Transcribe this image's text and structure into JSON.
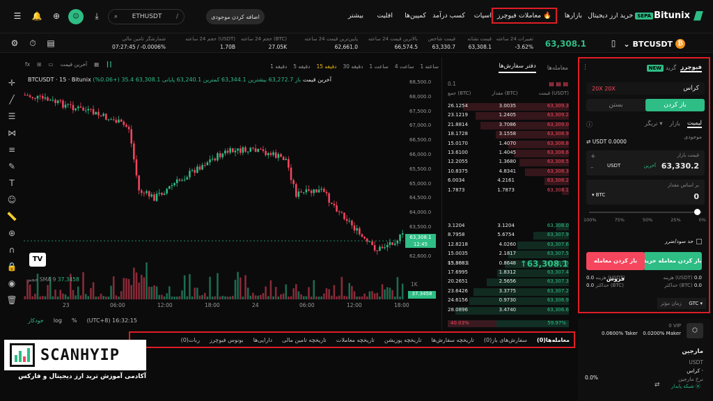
{
  "nav": {
    "brand": "Bitunix",
    "items": [
      "خرید ارز دیجیتال",
      "بازارها",
      "معاملات فیوچرز",
      "اسپات",
      "کسب درآمد",
      "کمپین‌ها",
      "افلیت",
      "بیشتر"
    ],
    "sepa": "SEPA",
    "search": "ETHUSDT",
    "deposit": "اضافه کردن موجودی"
  },
  "ticker": {
    "symbol": "BTCUSDT",
    "last": "63,308.1",
    "stats": [
      {
        "l": "تغییرات 24 ساعته",
        "v": "-3.62%"
      },
      {
        "l": "قیمت نشانه",
        "v": "63,308.1"
      },
      {
        "l": "قیمت شاخص",
        "v": "63,330.7"
      },
      {
        "l": "بالاترین قیمت 24 ساعته",
        "v": "66,574.5"
      },
      {
        "l": "پایین‌ترین قیمت 24 ساعته",
        "v": "62,661.0"
      },
      {
        "l": "حجم 24 ساعته (BTC)",
        "v": "27.05K"
      },
      {
        "l": "حجم 24 ساعته (USDT)",
        "v": "1.70B"
      },
      {
        "l": "شمارشگر تامین مالی",
        "v": "07:27:45 / -0.0006%"
      }
    ]
  },
  "chart": {
    "pair_line": "BTCUSDT · 15 · Bitunix آخرین قیمت",
    "ohlc": "باز 63,272.7  بیشترین 63,344.1  کمترین 63,240.1  پایانی 63,308.1  35.4 (+0.06%)",
    "intervals": [
      "1 دقیقه",
      "5 دقیقه",
      "15 دقیقه",
      "30 دقیقه",
      "1 ساعت",
      "4 ساعت",
      "1 ساعته"
    ],
    "price_type": "آخرین قیمت",
    "yticks": [
      "68,500.0",
      "68,000.0",
      "67,500.0",
      "67,000.0",
      "66,500.0",
      "66,000.0",
      "65,500.0",
      "65,000.0",
      "64,500.0",
      "64,000.0",
      "63,500.0",
      "63,000.0",
      "62,600.0"
    ],
    "xticks": [
      "23",
      "06:00",
      "12:00",
      "18:00",
      "24",
      "06:00",
      "12:00",
      "18:00"
    ],
    "price_tag": "63,308.1",
    "price_time": "12:45",
    "vol_label": "حجم",
    "sma": "SMA 9",
    "sma_val": "37.3458",
    "vol_tick": "1K",
    "vol_tag": "37.3458",
    "footer_time": "(UTC+8) 16:32:15",
    "footer_opts": [
      "%",
      "log",
      "خودکار"
    ]
  },
  "book": {
    "tabs": [
      "دفتر سفارش‌ها",
      "معامله‌ها"
    ],
    "step": "0.1",
    "headers": [
      "قیمت (USDT)",
      "مقدار (BTC)",
      "جمع (BTC)"
    ],
    "asks": [
      [
        "63,309.3",
        "3.0035",
        "26.1254"
      ],
      [
        "63,309.2",
        "1.2405",
        "23.1219"
      ],
      [
        "63,309.0",
        "3.7086",
        "21.8814"
      ],
      [
        "63,308.9",
        "3.1558",
        "18.1728"
      ],
      [
        "63,308.8",
        "1.4070",
        "15.0170"
      ],
      [
        "63,308.6",
        "1.4045",
        "13.6100"
      ],
      [
        "63,308.5",
        "1.3680",
        "12.2055"
      ],
      [
        "63,308.3",
        "4.8341",
        "10.8375"
      ],
      [
        "63,308.2",
        "4.2161",
        "6.0034"
      ],
      [
        "63,308.1",
        "1.7873",
        "1.7873"
      ]
    ],
    "mid": "↑63,308.1",
    "mid_sub": "63,308.1",
    "bids": [
      [
        "63,308.0",
        "3.1204",
        "3.1204"
      ],
      [
        "63,307.9",
        "5.6754",
        "8.7958"
      ],
      [
        "63,307.6",
        "4.0260",
        "12.8218"
      ],
      [
        "63,307.5",
        "2.1817",
        "15.0035"
      ],
      [
        "63,307.5",
        "0.8648",
        "15.8683"
      ],
      [
        "63,307.4",
        "1.8312",
        "17.6995"
      ],
      [
        "63,307.3",
        "2.5656",
        "20.2651"
      ],
      [
        "63,307.2",
        "3.3775",
        "23.6426"
      ],
      [
        "63,306.9",
        "0.9730",
        "24.6156"
      ],
      [
        "63,306.6",
        "3.4740",
        "28.0896"
      ]
    ],
    "ratio_b": "59.97%",
    "ratio_s": "40.03%"
  },
  "panel": {
    "title": "فیوچرز",
    "grid": "گرید",
    "new": "NEW",
    "mode": "کراس",
    "lev_a": "20X",
    "lev_b": "20X",
    "open": "باز کردن",
    "close": "بستن",
    "types": [
      "لیمیت",
      "بازار",
      "تریگر"
    ],
    "avail_l": "موجودی",
    "avail": "USDT 0.0000",
    "price_l": "قیمت بازار",
    "price": "63,330.2",
    "price_unit": "USDT",
    "price_latest": "آخرین",
    "qty_l": "بر اساس مقدار",
    "qty": "0",
    "qty_unit": "BTC",
    "pcts": [
      "100%",
      "75%",
      "50%",
      "25%",
      "0%"
    ],
    "tpsl": "حد سود/ضرر",
    "buy": "باز کردن معامله خرید",
    "sell": "باز کردن معامله فروش",
    "cost_l": "هزینه (USDT)",
    "cost": "0.0",
    "max_l": "حداکثر (BTC)",
    "max": "0.0",
    "tif_l": "زمان مؤثر",
    "tif": "GTC"
  },
  "fees": {
    "vip": "0 VIP",
    "maker": "0.0200% Maker",
    "taker": "0.0600% Taker",
    "margin": "مارجین",
    "margin_asset": "USDT",
    "margin_mode": "کراس ·",
    "rate": "نرخ مارجین",
    "rate_v": "0.0%",
    "network": "شبکه پایدار"
  },
  "bottom": {
    "tabs": [
      "معامله‌ها(0)",
      "سفارش‌های باز(0)",
      "تاریخچه سفارش‌ها",
      "تاریخچه پوزیشن",
      "تاریخچه معاملات",
      "تاریخچه تامین مالی",
      "دارایی‌ها",
      "بونوس فیوچرز",
      "ربات(0)"
    ]
  },
  "brand": {
    "name": "SCANHYIP",
    "sub": "آکادمی آموزش ترید ارز دیجیتال و فارکس"
  },
  "colors": {
    "up": "#2ebd85",
    "down": "#f6465d",
    "highlight": "#e11d24"
  },
  "icons": [
    "menu-icon",
    "bell-icon",
    "download-icon",
    "gift-icon",
    "search-icon",
    "settings-icon",
    "timer-icon",
    "calc-icon",
    "crosshair-icon",
    "trendline-icon",
    "fib-icon",
    "brush-icon",
    "text-icon",
    "emoji-icon",
    "ruler-icon",
    "zoom-icon",
    "lock-icon",
    "eye-icon",
    "trash-icon"
  ]
}
